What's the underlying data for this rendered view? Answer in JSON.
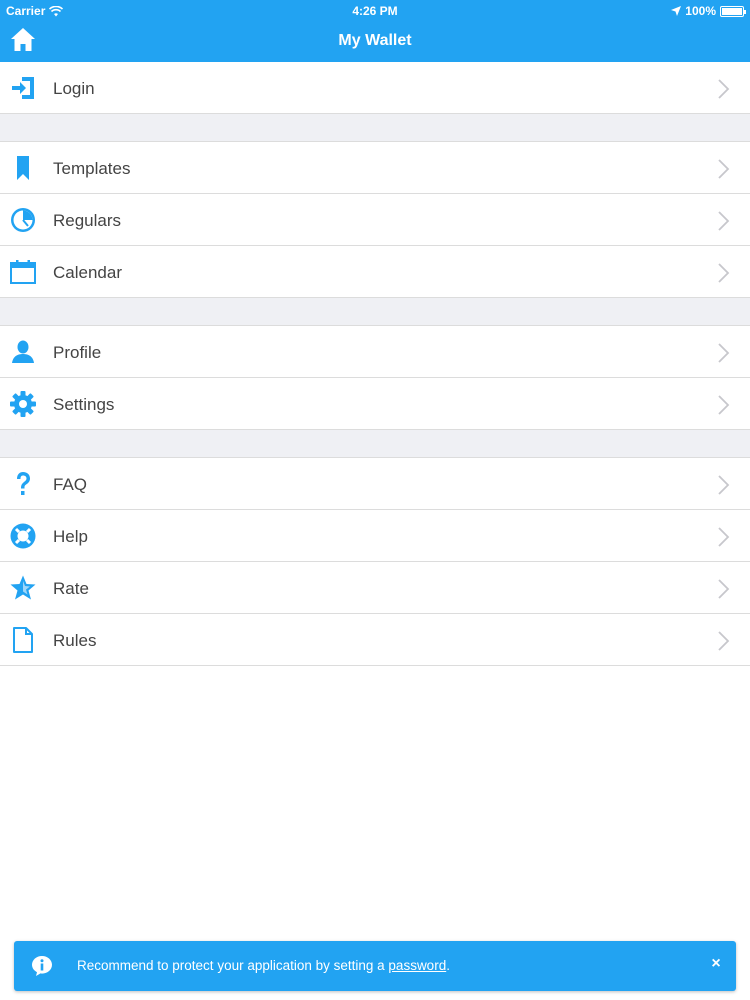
{
  "status_bar": {
    "carrier": "Carrier",
    "time": "4:26 PM",
    "battery": "100%",
    "battery_level": 1.0
  },
  "nav": {
    "title": "My Wallet",
    "home_icon": "home-icon"
  },
  "menu": {
    "groups": [
      {
        "items": [
          {
            "label": "Login",
            "icon": "login-icon"
          }
        ]
      },
      {
        "items": [
          {
            "label": "Templates",
            "icon": "bookmark-icon"
          },
          {
            "label": "Regulars",
            "icon": "clock-icon"
          },
          {
            "label": "Calendar",
            "icon": "calendar-icon"
          }
        ]
      },
      {
        "items": [
          {
            "label": "Profile",
            "icon": "user-icon"
          },
          {
            "label": "Settings",
            "icon": "gear-icon"
          }
        ]
      },
      {
        "items": [
          {
            "label": "FAQ",
            "icon": "question-icon"
          },
          {
            "label": "Help",
            "icon": "lifebuoy-icon"
          },
          {
            "label": "Rate",
            "icon": "star-icon"
          },
          {
            "label": "Rules",
            "icon": "document-icon"
          }
        ]
      }
    ]
  },
  "toast": {
    "message_prefix": "Recommend to protect your application by setting a ",
    "link_text": "password",
    "message_suffix": ".",
    "close_label": "×",
    "icon": "info-icon"
  },
  "colors": {
    "accent": "#22a3f2",
    "separator_gap": "#eff0f4",
    "chevron": "#c7c7cc"
  }
}
